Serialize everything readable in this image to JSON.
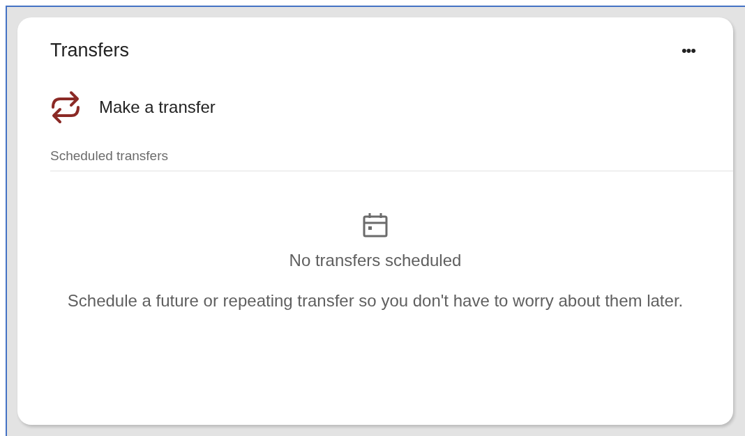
{
  "card": {
    "title": "Transfers",
    "menu_label": "•••"
  },
  "action": {
    "label": "Make a transfer"
  },
  "section": {
    "heading": "Scheduled transfers"
  },
  "empty_state": {
    "title": "No transfers scheduled",
    "message": "Schedule a future or repeating transfer so you don't have to worry about them later."
  }
}
